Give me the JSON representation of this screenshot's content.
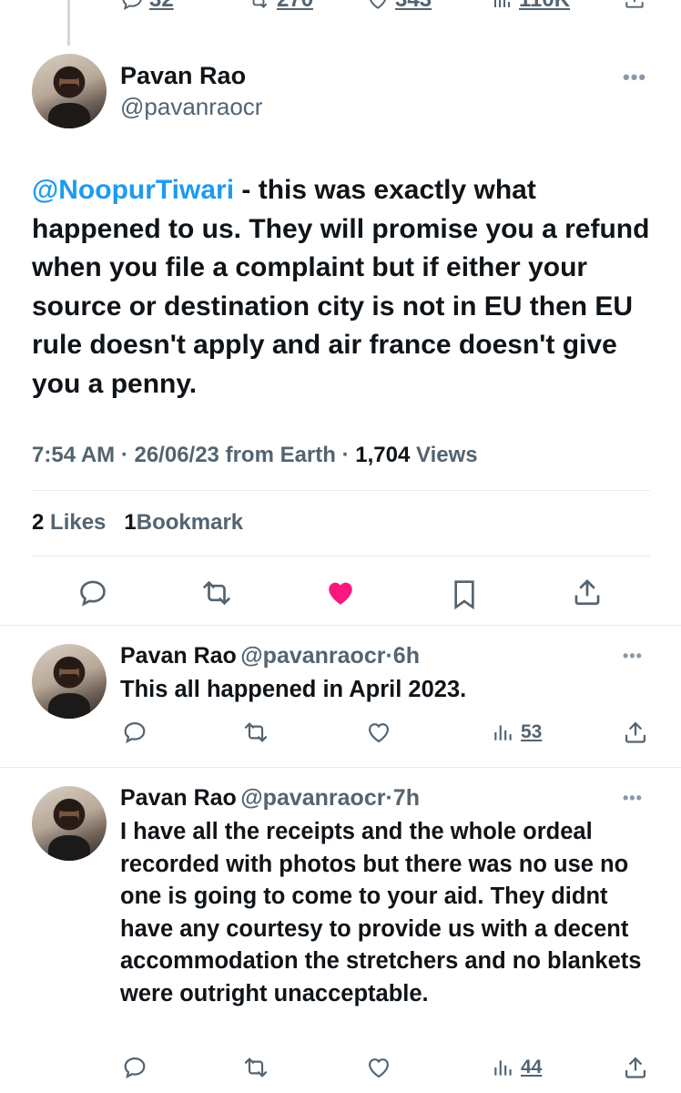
{
  "top_actions": {
    "replies": "32",
    "retweets": "270",
    "likes": "343",
    "views": "110K"
  },
  "main_tweet": {
    "author_name": "Pavan Rao",
    "author_handle": "@pavanraocr",
    "mention": "@NoopurTiwari",
    "text": " - this was exactly what happened to us. They will promise you a refund when you file a complaint but if either your source or destination city is not in EU then EU rule doesn't apply and air france doesn't give you a penny.",
    "time": "7:54 AM",
    "date": "26/06/23",
    "source": "from Earth",
    "views_count": "1,704",
    "views_label": "Views",
    "likes_count": "2",
    "likes_label": "Likes",
    "bookmarks_count": "1",
    "bookmarks_label": "Bookmark",
    "liked": true,
    "like_color": "#f91880"
  },
  "replies": [
    {
      "author_name": "Pavan Rao",
      "author_handle": "@pavanraocr",
      "age": "6h",
      "text": "This all happened in April 2023.",
      "views": "53"
    },
    {
      "author_name": "Pavan Rao",
      "author_handle": "@pavanraocr",
      "age": "7h",
      "text": "I have all the receipts and the whole ordeal recorded with photos but there was no use no one is going to come to your aid. They didnt have any courtesy to provide us with a decent accommodation the stretchers and no blankets were outright unacceptable.",
      "views": "44"
    }
  ],
  "separator": "·",
  "more_glyph": "•••",
  "colors": {
    "link": "#1d9bf0",
    "secondary": "#536471",
    "like": "#f91880"
  }
}
